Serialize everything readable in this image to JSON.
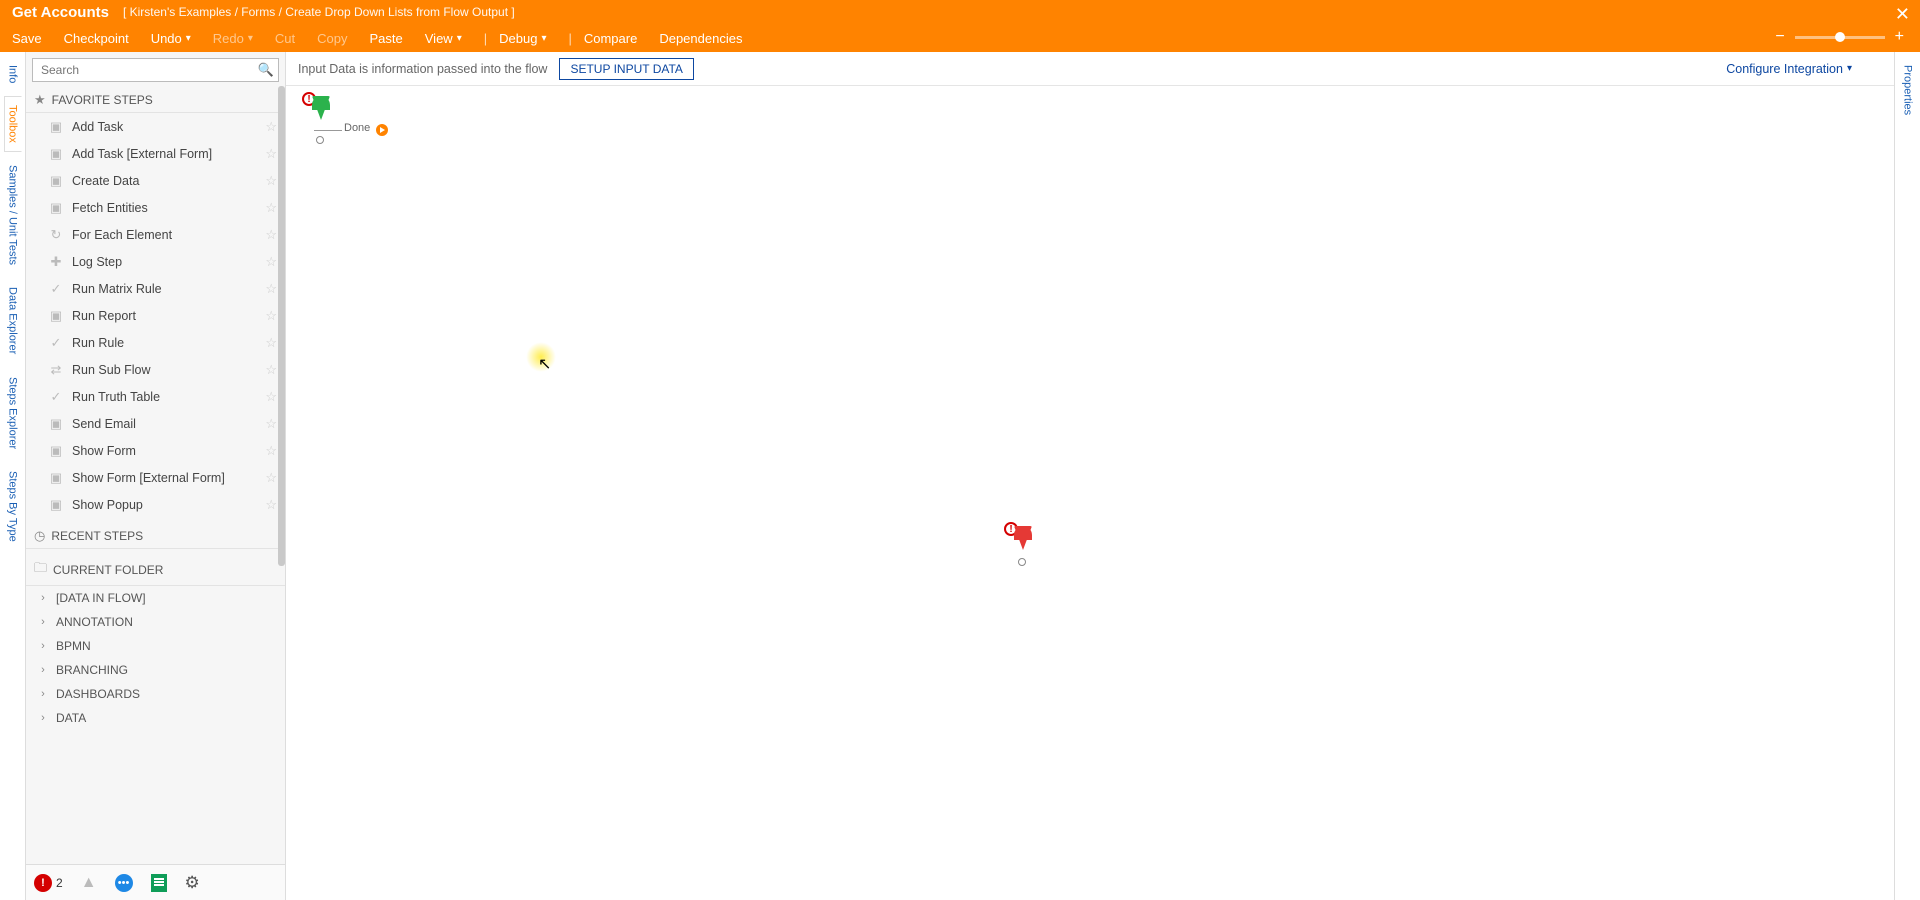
{
  "header": {
    "title": "Get Accounts",
    "breadcrumb": "[ Kirsten's Examples / Forms / Create Drop Down Lists from Flow Output ]",
    "menu": {
      "save": "Save",
      "checkpoint": "Checkpoint",
      "undo": "Undo",
      "redo": "Redo",
      "cut": "Cut",
      "copy": "Copy",
      "paste": "Paste",
      "view": "View",
      "debug": "Debug",
      "compare": "Compare",
      "dependencies": "Dependencies"
    }
  },
  "left_tabs": {
    "info": "Info",
    "toolbox": "Toolbox",
    "samples": "Samples / Unit Tests",
    "data_explorer": "Data Explorer",
    "steps_explorer": "Steps Explorer",
    "steps_by_type": "Steps By Type"
  },
  "right_tabs": {
    "properties": "Properties"
  },
  "search": {
    "placeholder": "Search"
  },
  "sections": {
    "favorite": "FAVORITE STEPS",
    "recent": "RECENT STEPS",
    "current": "CURRENT FOLDER"
  },
  "favorites": [
    {
      "label": "Add Task",
      "icon": "cube-icon"
    },
    {
      "label": "Add Task [External Form]",
      "icon": "cube-icon"
    },
    {
      "label": "Create Data",
      "icon": "cube-icon"
    },
    {
      "label": "Fetch Entities",
      "icon": "cube-icon"
    },
    {
      "label": "For Each Element",
      "icon": "loop-icon"
    },
    {
      "label": "Log Step",
      "icon": "plus-icon"
    },
    {
      "label": "Run Matrix Rule",
      "icon": "check-icon"
    },
    {
      "label": "Run Report",
      "icon": "cube-icon"
    },
    {
      "label": "Run Rule",
      "icon": "check-icon"
    },
    {
      "label": "Run Sub Flow",
      "icon": "flow-icon"
    },
    {
      "label": "Run Truth Table",
      "icon": "check-icon"
    },
    {
      "label": "Send Email",
      "icon": "cube-icon"
    },
    {
      "label": "Show Form",
      "icon": "cube-icon"
    },
    {
      "label": "Show Form [External Form]",
      "icon": "cube-icon"
    },
    {
      "label": "Show Popup",
      "icon": "cube-icon"
    }
  ],
  "categories": [
    "[DATA IN FLOW]",
    "ANNOTATION",
    "BPMN",
    "BRANCHING",
    "DASHBOARDS",
    "DATA"
  ],
  "footer": {
    "error_count": "2"
  },
  "canvas_toolbar": {
    "hint": "Input Data is information passed into the flow",
    "setup_button": "SETUP INPUT DATA",
    "configure": "Configure Integration"
  },
  "canvas": {
    "done_label": "Done"
  }
}
